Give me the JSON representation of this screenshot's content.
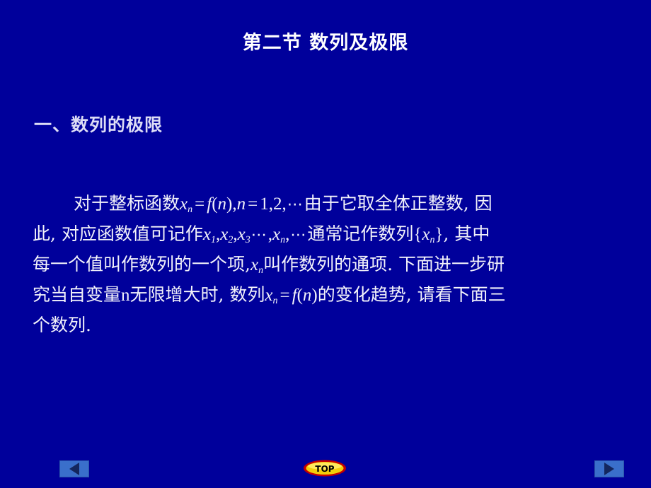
{
  "slide": {
    "title": "第二节  数列及极限",
    "section_heading": "一、数列的极限",
    "background_color": "#00009B",
    "title_color": "#FFFFFF",
    "heading_color": "#DCDCF5",
    "body_color": "#F2F2FA",
    "body": {
      "line1": {
        "part1": "对于整标函数",
        "var1": "x",
        "sub1": "n",
        "eq1": "=",
        "fn1": "f",
        "paren1": "(",
        "n1": "n",
        "paren2": ")",
        "comma1": ",",
        "var2": "n",
        "eq2": "=",
        "num1": "1,",
        "num2": "2,",
        "dots1": "⋯",
        "part2": "由于它取全体正整数, 因"
      },
      "line2": {
        "part1": "此, 对应函数值可记作",
        "x1": "x",
        "x1sub": "1",
        "c1": ",",
        "x2": "x",
        "x2sub": "2",
        "c2": ",",
        "x3": "x",
        "x3sub": "3",
        "dots1": "⋯",
        "c3": ",",
        "xn": "x",
        "xnsub": "n",
        "c4": ",",
        "dots2": "⋯",
        "part2": "通常记作数列",
        "brace_open": "{",
        "xb": "x",
        "xbsub": "n",
        "brace_close": "}",
        "part3": ", 其中"
      },
      "line3": {
        "part1": "每一个值叫作数列的一个项,",
        "var1": "x",
        "sub1": "n",
        "part2": "叫作数列的通项. 下面进一步研"
      },
      "line4": {
        "part1": "究当自变量",
        "var1": "n",
        "part2": "无限增大时, 数列",
        "var2": "x",
        "sub2": "n",
        "eq1": "=",
        "fn1": "f",
        "paren1": "(",
        "n1": "n",
        "paren2": ")",
        "part3": "的变化趋势, 请看下面三"
      },
      "line5": {
        "part1": "个数列."
      }
    }
  },
  "navigation": {
    "back_label": "back-arrow",
    "top_label": "TOP",
    "next_label": "next-arrow",
    "button_face_color": "#3A6FCB",
    "arrow_color": "#14265E",
    "top_fill_color": "#F2CE0A",
    "top_outline_color": "#C40000",
    "top_text_color": "#000000"
  }
}
